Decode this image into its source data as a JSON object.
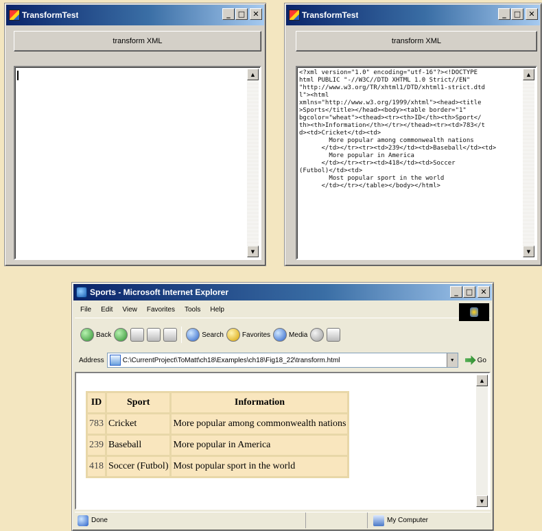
{
  "win1": {
    "title": "TransformTest",
    "button": "transform XML",
    "textarea_value": ""
  },
  "win2": {
    "title": "TransformTest",
    "button": "transform XML",
    "textarea_value": "<?xml version=\"1.0\" encoding=\"utf-16\"?><!DOCTYPE\nhtml PUBLIC \"-//W3C//DTD XHTML 1.0 Strict//EN\"\n\"http://www.w3.org/TR/xhtml1/DTD/xhtml1-strict.dtd\nl\"><html\nxmlns=\"http://www.w3.org/1999/xhtml\"><head><title\n>Sports</title></head><body><table border=\"1\"\nbgcolor=\"wheat\"><thead><tr><th>ID</th><th>Sport</\nth><th>Information</th></tr></thead><tr><td>783</t\nd><td>Cricket</td><td>\n        More popular among commonwealth nations\n      </td></tr><tr><td>239</td><td>Baseball</td><td>\n        More popular in America\n      </td></tr><tr><td>418</td><td>Soccer\n(Futbol)</td><td>\n        Most popular sport in the world\n      </td></tr></table></body></html>"
  },
  "ie": {
    "title": "Sports - Microsoft Internet Explorer",
    "menu": [
      "File",
      "Edit",
      "View",
      "Favorites",
      "Tools",
      "Help"
    ],
    "toolbar": {
      "back": "Back",
      "search": "Search",
      "favorites": "Favorites",
      "media": "Media"
    },
    "address_label": "Address",
    "address_value": "C:\\CurrentProject\\ToMatt\\ch18\\Examples\\ch18\\Fig18_22\\transform.html",
    "go_label": "Go",
    "status_left": "Done",
    "status_right": "My Computer",
    "table": {
      "headers": [
        "ID",
        "Sport",
        "Information"
      ],
      "rows": [
        [
          "783",
          "Cricket",
          "More popular among commonwealth nations"
        ],
        [
          "239",
          "Baseball",
          "More popular in America"
        ],
        [
          "418",
          "Soccer (Futbol)",
          "Most popular sport in the world"
        ]
      ]
    }
  },
  "colors": {
    "background": "#f3e6c0",
    "titlebar_start": "#0a246a",
    "titlebar_end": "#a6caf0",
    "table_cell": "#f9e6be"
  }
}
